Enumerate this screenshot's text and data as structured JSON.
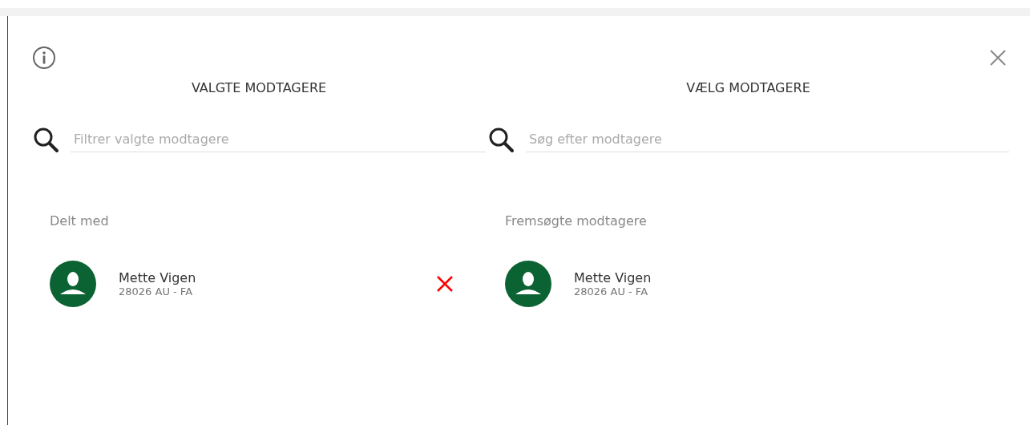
{
  "columns": [
    {
      "heading": "VALGTE MODTAGERE",
      "search": {
        "placeholder": "Filtrer valgte modtagere"
      },
      "section": "Delt med",
      "people": [
        {
          "name": "Mette Vigen",
          "detail": "28026 AU - FA",
          "removable": true
        }
      ]
    },
    {
      "heading": "VÆLG MODTAGERE",
      "search": {
        "placeholder": "Søg efter modtagere"
      },
      "section": "Fremsøgte modtagere",
      "people": [
        {
          "name": "Mette Vigen",
          "detail": "28026 AU - FA",
          "removable": false
        }
      ]
    }
  ]
}
